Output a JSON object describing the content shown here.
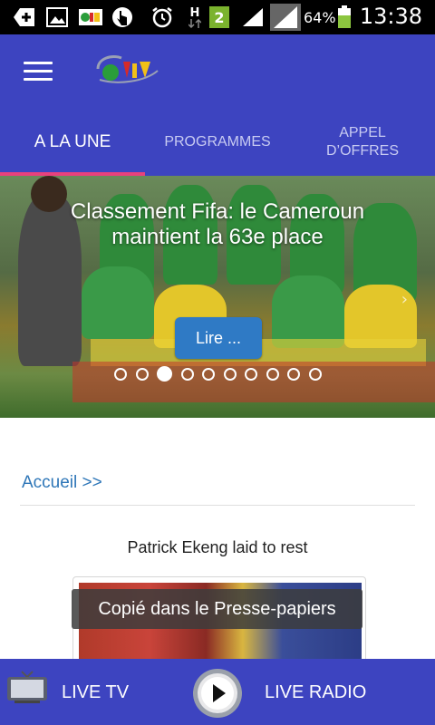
{
  "status_bar": {
    "battery_percent": "64%",
    "time": "13:38",
    "network_type": "H",
    "sim_badge": "2",
    "icons": [
      "add-icon",
      "image-icon",
      "crtv-notification-icon",
      "tap-icon",
      "alarm-icon",
      "network-h-icon",
      "sim-2-icon",
      "signal-icon",
      "signal-icon",
      "battery-icon"
    ]
  },
  "app_bar": {
    "logo_name": "crtv-logo",
    "menu_icon": "hamburger-icon"
  },
  "tabs": [
    {
      "label": "A LA UNE",
      "active": true
    },
    {
      "label": "PROGRAMMES",
      "active": false
    },
    {
      "label": "APPEL D’OFFRES",
      "active": false
    }
  ],
  "hero": {
    "title": "Classement Fifa: le Cameroun maintient la 63e place",
    "button_label": "Lire ...",
    "slide_count": 10,
    "active_slide": 3
  },
  "content": {
    "breadcrumb": "Accueil >>",
    "article_title": "Patrick Ekeng laid to rest"
  },
  "toast": {
    "message": "Copié dans le Presse-papiers"
  },
  "bottom_bar": {
    "live_tv_label": "LIVE TV",
    "live_radio_label": "LIVE RADIO"
  },
  "colors": {
    "primary": "#3d44c0",
    "accent": "#e8417d",
    "button": "#2f7ac5",
    "link": "#2f77b8"
  }
}
